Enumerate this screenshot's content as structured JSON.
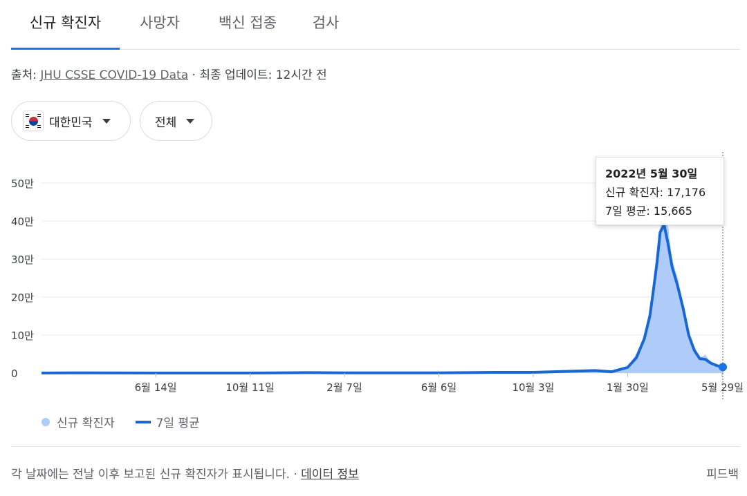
{
  "tabs": [
    {
      "label": "신규 확진자",
      "active": true
    },
    {
      "label": "사망자",
      "active": false
    },
    {
      "label": "백신 접종",
      "active": false
    },
    {
      "label": "검사",
      "active": false
    }
  ],
  "source": {
    "prefix": "출처: ",
    "link": "JHU CSSE COVID-19 Data",
    "suffix": " · 최종 업데이트: 12시간 전"
  },
  "filters": {
    "country": "대한민국",
    "scope": "전체"
  },
  "tooltip": {
    "date": "2022년 5월 30일",
    "cases": "신규 확진자: 17,176",
    "avg": "7일 평균: 15,665"
  },
  "legend": {
    "cases": "신규 확진자",
    "avg": "7일 평균"
  },
  "footer": {
    "note": "각 날짜에는 전날 이후 보고된 신규 확진자가 표시됩니다. · ",
    "link": "데이터 정보",
    "feedback": "피드백"
  },
  "colors": {
    "bars": "#aecbfa",
    "line": "#1967d2",
    "accent": "#1a73e8"
  },
  "chart_data": {
    "type": "area",
    "ylim": [
      0,
      500000
    ],
    "yticks": [
      {
        "value": 0,
        "label": "0"
      },
      {
        "value": 100000,
        "label": "10만"
      },
      {
        "value": 200000,
        "label": "20만"
      },
      {
        "value": 300000,
        "label": "30만"
      },
      {
        "value": 400000,
        "label": "40만"
      },
      {
        "value": 500000,
        "label": "50만"
      }
    ],
    "xlim": [
      "2020-01-22",
      "2022-05-30"
    ],
    "xticks": [
      {
        "date": "2020-06-14",
        "label": "6월 14일"
      },
      {
        "date": "2020-10-11",
        "label": "10월 11일"
      },
      {
        "date": "2021-02-07",
        "label": "2월 7일"
      },
      {
        "date": "2021-06-06",
        "label": "6월 6일"
      },
      {
        "date": "2021-10-03",
        "label": "10월 3일"
      },
      {
        "date": "2022-01-30",
        "label": "1월 30일"
      },
      {
        "date": "2022-05-29",
        "label": "5월 29일"
      }
    ],
    "series": [
      {
        "name": "신규 확진자",
        "kind": "bars",
        "points": [
          [
            "2020-01-22",
            0
          ],
          [
            "2020-03-01",
            700
          ],
          [
            "2020-06-14",
            40
          ],
          [
            "2020-10-11",
            80
          ],
          [
            "2020-12-25",
            1100
          ],
          [
            "2021-02-07",
            350
          ],
          [
            "2021-06-06",
            500
          ],
          [
            "2021-08-15",
            1900
          ],
          [
            "2021-10-03",
            2000
          ],
          [
            "2021-12-20",
            7000
          ],
          [
            "2022-01-10",
            3500
          ],
          [
            "2022-01-30",
            17000
          ],
          [
            "2022-02-10",
            50000
          ],
          [
            "2022-02-20",
            100000
          ],
          [
            "2022-02-27",
            160000
          ],
          [
            "2022-03-03",
            220000
          ],
          [
            "2022-03-08",
            300000
          ],
          [
            "2022-03-12",
            380000
          ],
          [
            "2022-03-17",
            450000
          ],
          [
            "2022-03-22",
            380000
          ],
          [
            "2022-03-27",
            300000
          ],
          [
            "2022-04-03",
            250000
          ],
          [
            "2022-04-10",
            180000
          ],
          [
            "2022-04-17",
            110000
          ],
          [
            "2022-04-24",
            70000
          ],
          [
            "2022-05-01",
            40000
          ],
          [
            "2022-05-08",
            48000
          ],
          [
            "2022-05-15",
            28000
          ],
          [
            "2022-05-22",
            22000
          ],
          [
            "2022-05-30",
            17176
          ]
        ]
      },
      {
        "name": "7일 평균",
        "kind": "line",
        "points": [
          [
            "2020-01-22",
            0
          ],
          [
            "2020-03-01",
            500
          ],
          [
            "2020-06-14",
            40
          ],
          [
            "2020-10-11",
            80
          ],
          [
            "2020-12-25",
            1000
          ],
          [
            "2021-02-07",
            350
          ],
          [
            "2021-06-06",
            500
          ],
          [
            "2021-08-15",
            1800
          ],
          [
            "2021-10-03",
            1900
          ],
          [
            "2021-12-20",
            6500
          ],
          [
            "2022-01-10",
            3500
          ],
          [
            "2022-01-30",
            15000
          ],
          [
            "2022-02-10",
            40000
          ],
          [
            "2022-02-20",
            90000
          ],
          [
            "2022-02-27",
            150000
          ],
          [
            "2022-03-03",
            210000
          ],
          [
            "2022-03-08",
            290000
          ],
          [
            "2022-03-12",
            370000
          ],
          [
            "2022-03-17",
            390000
          ],
          [
            "2022-03-22",
            340000
          ],
          [
            "2022-03-27",
            280000
          ],
          [
            "2022-04-03",
            230000
          ],
          [
            "2022-04-10",
            170000
          ],
          [
            "2022-04-17",
            100000
          ],
          [
            "2022-04-24",
            60000
          ],
          [
            "2022-05-01",
            38000
          ],
          [
            "2022-05-08",
            36000
          ],
          [
            "2022-05-15",
            26000
          ],
          [
            "2022-05-22",
            20000
          ],
          [
            "2022-05-30",
            15665
          ]
        ]
      }
    ],
    "highlight": {
      "date": "2022-05-30"
    },
    "grid": true
  }
}
